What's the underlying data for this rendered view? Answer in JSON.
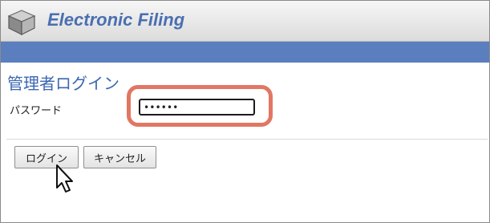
{
  "header": {
    "app_title": "Electronic Filing",
    "logo_icon": "cube-icon"
  },
  "login": {
    "page_title": "管理者ログイン",
    "password_label": "パスワード",
    "password_value": "••••••",
    "login_button": "ログイン",
    "cancel_button": "キャンセル"
  },
  "colors": {
    "title_blue": "#4a6fb1",
    "bar_blue": "#5b7ebf",
    "highlight": "#e17763"
  },
  "pointer": "mouse-pointer-icon"
}
